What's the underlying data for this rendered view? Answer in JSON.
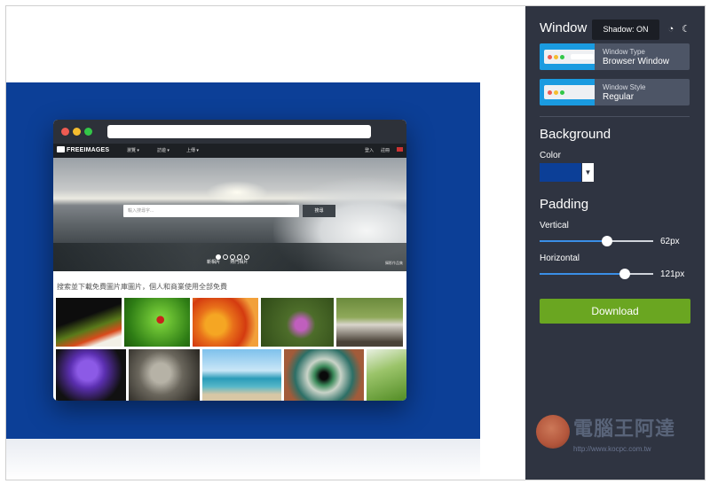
{
  "preview": {
    "background_color": "#0c3f97",
    "browser": {
      "site_logo": "FREEIMAGES",
      "nav_links": [
        "瀏覽 ▾",
        "訪遊 ▾",
        "上傳 ▾"
      ],
      "nav_right": [
        "登入",
        "註冊"
      ],
      "search_placeholder": "輸入搜尋字...",
      "search_button": "搜尋",
      "hero_tabs": [
        "新相片",
        "熱門相片"
      ],
      "hero_right": "攝影作品集",
      "tagline": "搜索並下載免費圖片庫圖片，個人和商業使用全部免費"
    }
  },
  "sidebar": {
    "window_title": "Window",
    "tooltip": "Shadow: ON",
    "icons": [
      "shadow-toggle-icon",
      "dark-mode-moon-icon"
    ],
    "presets": [
      {
        "type_label": "Window Type",
        "value": "Browser Window"
      },
      {
        "type_label": "Window Style",
        "value": "Regular"
      }
    ],
    "background_title": "Background",
    "color_label": "Color",
    "color_value": "#0c3f97",
    "padding_title": "Padding",
    "vertical_label": "Vertical",
    "vertical_value": "62px",
    "vertical_fraction": 0.6,
    "horizontal_label": "Horizontal",
    "horizontal_value": "121px",
    "horizontal_fraction": 0.78,
    "download_label": "Download",
    "accent_color": "#6aa621"
  },
  "watermark": {
    "title": "電腦王阿達",
    "url": "http://www.kocpc.com.tw"
  }
}
